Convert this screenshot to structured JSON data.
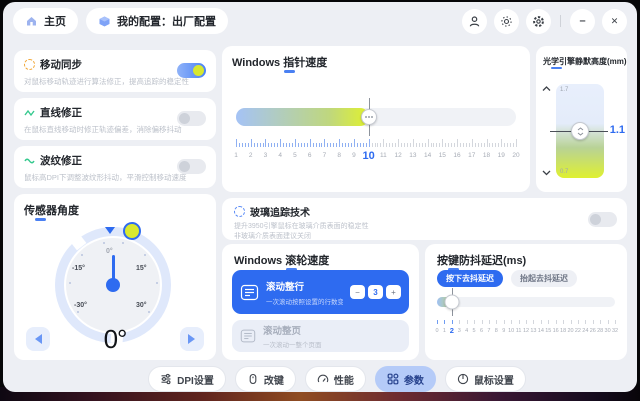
{
  "colors": {
    "accent_blue": "#2e6bf0",
    "toggle_knob_green": "#d7e72f",
    "slider_blue": "#a5c3f6",
    "slider_yellow": "#e0f12e",
    "nav_selected_bg": "#b5cbf8"
  },
  "window": {
    "topbar": {
      "home": "主页",
      "config": "我的配置：出厂配置"
    },
    "window_controls": {
      "minimize_glyph": "–",
      "close_glyph": "✕"
    },
    "corrections": [
      {
        "title": "移动同步",
        "desc": "对鼠标移动轨迹进行算法修正，提高追踪的稳定性",
        "on": true,
        "icon": "dashed-circle-icon"
      },
      {
        "title": "直线修正",
        "desc": "在鼠标直线移动时修正轨迹偏差，消除偏移抖动",
        "on": false,
        "icon": "zigzag-icon"
      },
      {
        "title": "波纹修正",
        "desc": "鼠标高DPI下调整波纹形抖动，平滑控制移动速度",
        "on": false,
        "icon": "wave-icon"
      }
    ],
    "sensor_angle": {
      "title": "传感器角度",
      "value": "0°",
      "dial_labels": {
        "top": "0°",
        "left": "-15°",
        "right": "15°",
        "bottom_left": "-30°",
        "bottom_right": "30°"
      }
    },
    "pointer_speed": {
      "title": "Windows 指针速度",
      "min": 1,
      "max": 20,
      "value": 10
    },
    "lod": {
      "title": "光学引擎静默高度(mm)",
      "max_label": "1.7",
      "min_label": "0.7",
      "value": "1.1"
    },
    "glass_tracking": {
      "title": "玻璃追踪技术",
      "desc_line1": "提升3950引擎鼠标在玻璃介质表面的稳定性",
      "desc_line2": "非玻璃介质表面建议关闭",
      "on": false
    },
    "scroll_speed": {
      "title": "Windows 滚轮速度",
      "options": [
        {
          "title": "滚动整行",
          "desc": "一次滚动按照设置的行数变化",
          "selected": true,
          "stepper": {
            "minus": "−",
            "value": "3",
            "plus": "+"
          }
        },
        {
          "title": "滚动整页",
          "desc": "一次滚动一整个页面",
          "selected": false
        }
      ]
    },
    "debounce": {
      "title": "按键防抖延迟(ms)",
      "tabs": [
        {
          "label": "按下去抖延迟",
          "selected": true
        },
        {
          "label": "抬起去抖延迟",
          "selected": false
        }
      ],
      "value": 2,
      "tick_labels": [
        "0",
        "1",
        "2",
        "3",
        "4",
        "5",
        "6",
        "7",
        "8",
        "9",
        "10",
        "11",
        "12",
        "13",
        "14",
        "15",
        "16",
        "18",
        "20",
        "22",
        "24",
        "26",
        "28",
        "30",
        "32"
      ]
    },
    "bottom_nav": [
      {
        "label": "DPI设置",
        "icon": "sliders-icon",
        "selected": false
      },
      {
        "label": "改键",
        "icon": "mouse-icon",
        "selected": false
      },
      {
        "label": "性能",
        "icon": "gauge-icon",
        "selected": false
      },
      {
        "label": "参数",
        "icon": "grid-icon",
        "selected": true
      },
      {
        "label": "鼠标设置",
        "icon": "mouse-settings-icon",
        "selected": false
      }
    ]
  }
}
